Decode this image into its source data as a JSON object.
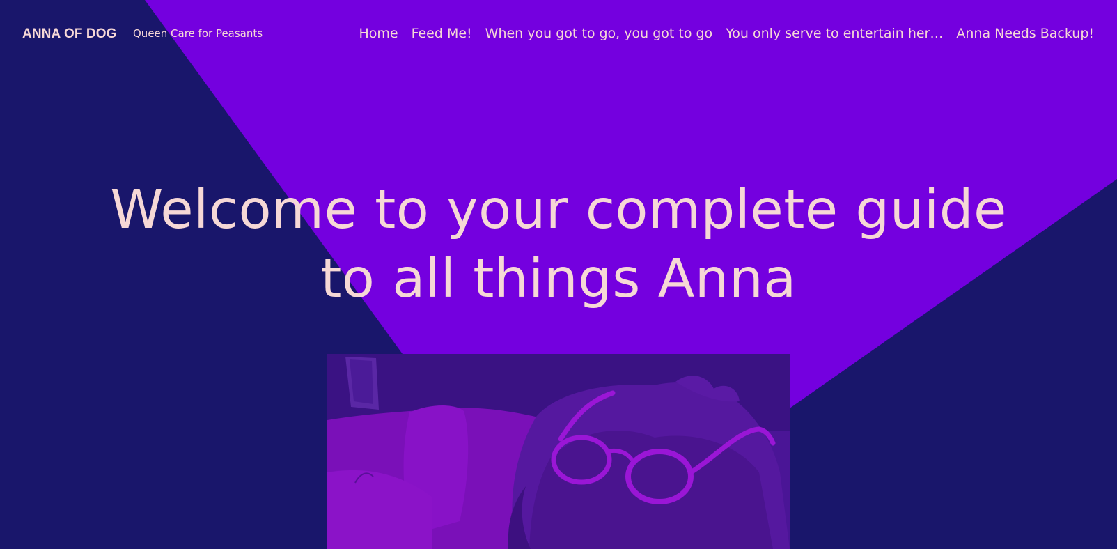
{
  "site": {
    "title": "ANNA OF DOG",
    "tagline": "Queen Care for Peasants"
  },
  "nav": {
    "items": [
      {
        "label": "Home"
      },
      {
        "label": "Feed Me!"
      },
      {
        "label": "When you got to go, you got to go"
      },
      {
        "label": "You only serve to entertain her…"
      },
      {
        "label": "Anna Needs Backup!"
      }
    ]
  },
  "hero": {
    "heading": "Welcome to your complete guide to all things Anna",
    "image_alt": "Dog wearing round glasses lying on a bed"
  },
  "colors": {
    "background_dark": "#19166b",
    "background_accent": "#7400df",
    "text": "#f6d8d6",
    "photo_tint": "#4a1596"
  }
}
